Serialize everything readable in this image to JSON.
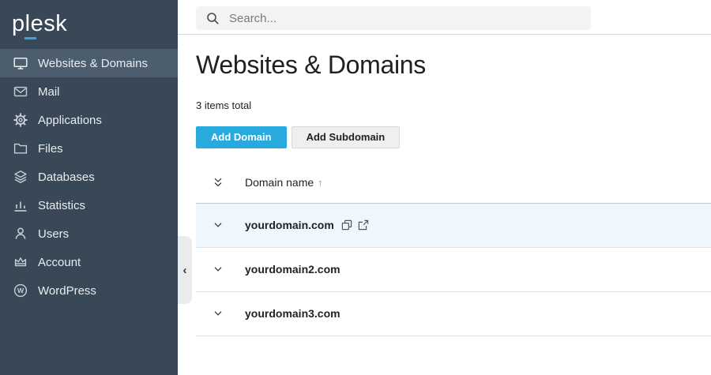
{
  "brand": {
    "logo_text": "plesk"
  },
  "sidebar": {
    "items": [
      {
        "label": "Websites & Domains",
        "icon": "monitor-icon",
        "active": true
      },
      {
        "label": "Mail",
        "icon": "envelope-icon",
        "active": false
      },
      {
        "label": "Applications",
        "icon": "gear-icon",
        "active": false
      },
      {
        "label": "Files",
        "icon": "folder-icon",
        "active": false
      },
      {
        "label": "Databases",
        "icon": "layers-icon",
        "active": false
      },
      {
        "label": "Statistics",
        "icon": "bar-chart-icon",
        "active": false
      },
      {
        "label": "Users",
        "icon": "user-icon",
        "active": false
      },
      {
        "label": "Account",
        "icon": "crown-icon",
        "active": false
      },
      {
        "label": "WordPress",
        "icon": "wordpress-icon",
        "active": false
      }
    ],
    "collapse_glyph": "‹"
  },
  "topbar": {
    "search_placeholder": "Search..."
  },
  "page": {
    "title": "Websites & Domains",
    "items_total": "3 items total"
  },
  "actions": {
    "add_domain": "Add Domain",
    "add_subdomain": "Add Subdomain"
  },
  "table": {
    "header": {
      "label": "Domain name",
      "sort_indicator": "↑"
    },
    "rows": [
      {
        "name": "yourdomain.com",
        "highlighted": true,
        "icons": [
          "copy-icon",
          "open-in-new-icon"
        ]
      },
      {
        "name": "yourdomain2.com",
        "highlighted": false
      },
      {
        "name": "yourdomain3.com",
        "highlighted": false
      }
    ]
  },
  "colors": {
    "accent_blue": "#28aade",
    "sidebar_bg": "#384856",
    "sidebar_active_bg": "#4c5e6e",
    "row_highlight": "#eef7fc",
    "logo_dash": "#38a3dc"
  }
}
